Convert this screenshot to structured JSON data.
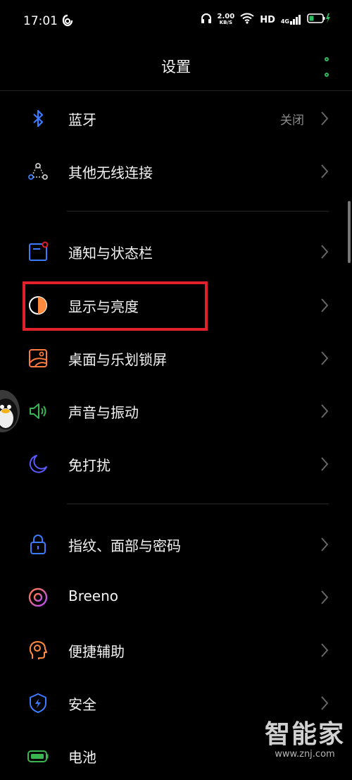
{
  "status_bar": {
    "time": "17:01",
    "net_speed_value": "2.00",
    "net_speed_unit": "KB/S",
    "hd": "HD",
    "signal_label": "4G"
  },
  "header": {
    "title": "设置"
  },
  "settings": {
    "bluetooth": {
      "label": "蓝牙",
      "value": "关闭",
      "icon": "bluetooth-icon",
      "color": "#3a7bff"
    },
    "other_wireless": {
      "label": "其他无线连接",
      "icon": "connection-icon",
      "color": "#c8c8c8"
    },
    "notification": {
      "label": "通知与状态栏",
      "icon": "notification-icon",
      "color": "#3a7bff"
    },
    "display": {
      "label": "显示与亮度",
      "icon": "brightness-icon",
      "color": "#ff8a3d"
    },
    "desktop": {
      "label": "桌面与乐划锁屏",
      "icon": "wallpaper-icon",
      "color": "#ff7a3d"
    },
    "sound": {
      "label": "声音与振动",
      "icon": "speaker-icon",
      "color": "#3bb552"
    },
    "dnd": {
      "label": "免打扰",
      "icon": "moon-icon",
      "color": "#5a5aff"
    },
    "security_password": {
      "label": "指纹、面部与密码",
      "icon": "lock-icon",
      "color": "#3a7bff"
    },
    "breeno": {
      "label": "Breeno",
      "icon": "breeno-icon",
      "color": "#e0508a"
    },
    "accessibility": {
      "label": "便捷辅助",
      "icon": "accessibility-icon",
      "color": "#ff8a3d"
    },
    "security": {
      "label": "安全",
      "icon": "shield-icon",
      "color": "#3a7bff"
    },
    "battery": {
      "label": "电池",
      "icon": "battery-icon",
      "color": "#3bb552"
    }
  },
  "watermark": {
    "main": "智能家",
    "url": "www.znj.com"
  },
  "colors": {
    "accent_green": "#2dbb5f",
    "highlight_red": "#e0202a"
  }
}
